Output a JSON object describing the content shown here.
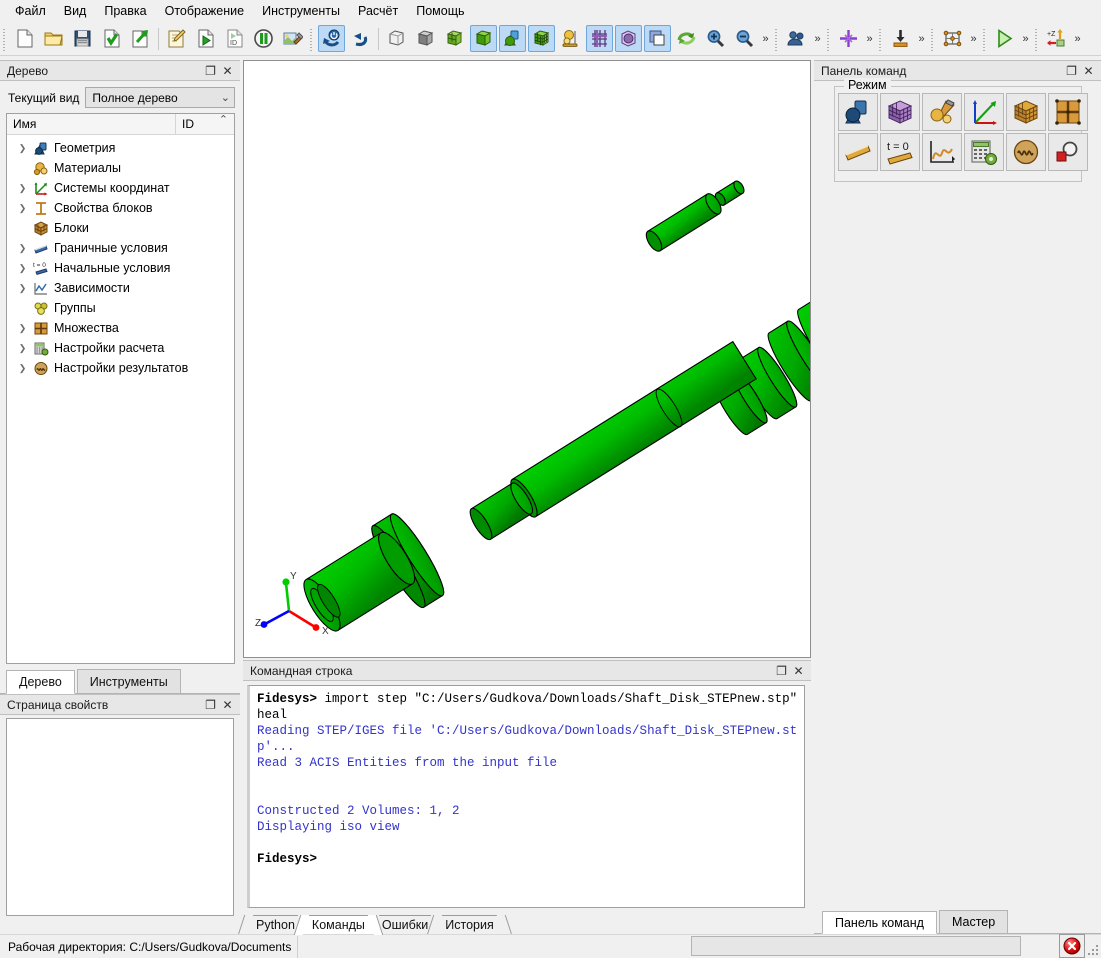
{
  "menubar": {
    "items": [
      {
        "label": "Файл",
        "name": "menu-file"
      },
      {
        "label": "Вид",
        "name": "menu-view"
      },
      {
        "label": "Правка",
        "name": "menu-edit"
      },
      {
        "label": "Отображение",
        "name": "menu-display"
      },
      {
        "label": "Инструменты",
        "name": "menu-tools"
      },
      {
        "label": "Расчёт",
        "name": "menu-calc"
      },
      {
        "label": "Помощь",
        "name": "menu-help"
      }
    ]
  },
  "toolbar": {
    "overflow_glyph": "»",
    "groups": [
      {
        "name": "file-toolbar",
        "buttons": [
          {
            "icon": "new-document-icon",
            "checked": false
          },
          {
            "icon": "open-folder-icon",
            "checked": false
          },
          {
            "icon": "save-icon",
            "checked": false
          },
          {
            "icon": "import-icon",
            "checked": false
          },
          {
            "icon": "export-icon",
            "checked": false
          },
          {
            "sep": true
          },
          {
            "icon": "edit-journal-icon",
            "checked": false
          },
          {
            "icon": "play-journal-icon",
            "checked": false
          },
          {
            "icon": "journal-id-icon",
            "checked": false
          },
          {
            "icon": "pause-icon",
            "checked": false
          },
          {
            "icon": "build-icon",
            "checked": false
          }
        ]
      },
      {
        "name": "undo-redo-toolbar",
        "buttons": [
          {
            "icon": "reset-icon",
            "checked": true
          },
          {
            "icon": "undo-icon",
            "checked": false
          },
          {
            "sep": true
          },
          {
            "icon": "wireframe-icon",
            "checked": false
          },
          {
            "icon": "hidden-line-icon",
            "checked": false
          },
          {
            "icon": "shaded-wireframe-icon",
            "checked": false
          },
          {
            "icon": "shaded-icon",
            "checked": true
          },
          {
            "icon": "smooth-shade-icon",
            "checked": true
          },
          {
            "icon": "mesh-shaded-icon",
            "checked": true
          },
          {
            "icon": "composite-icon",
            "checked": false
          },
          {
            "icon": "grid-icon",
            "checked": true
          },
          {
            "icon": "transparency-icon",
            "checked": true
          },
          {
            "icon": "clip-plane-icon",
            "checked": true
          },
          {
            "icon": "refresh-view-icon",
            "checked": false
          },
          {
            "icon": "zoom-in-icon",
            "checked": false
          },
          {
            "icon": "zoom-out-icon",
            "checked": false
          }
        ]
      },
      {
        "name": "group-toolbar",
        "buttons": [
          {
            "icon": "groups-icon",
            "checked": false
          }
        ]
      },
      {
        "name": "picking-toolbar",
        "buttons": [
          {
            "icon": "crosshair-icon",
            "checked": false
          }
        ]
      },
      {
        "name": "boundary-toolbar",
        "buttons": [
          {
            "icon": "load-arrow-icon",
            "checked": false
          }
        ]
      },
      {
        "name": "mesh-toolbar",
        "buttons": [
          {
            "icon": "mesh-nodes-icon",
            "checked": false
          }
        ]
      },
      {
        "name": "run-toolbar",
        "buttons": [
          {
            "icon": "run-play-icon",
            "checked": false
          }
        ]
      },
      {
        "name": "view-axis-toolbar",
        "buttons": [
          {
            "icon": "plus-z-view-icon",
            "checked": false
          }
        ]
      }
    ]
  },
  "tree_panel": {
    "title": "Дерево",
    "restore_glyph": "❐",
    "close_glyph": "✕",
    "view_label": "Текущий вид",
    "view_value": "Полное дерево",
    "chevron_glyph": "⌄",
    "columns": {
      "name": "Имя",
      "id": "ID"
    },
    "sort_glyph": "⌃",
    "items": [
      {
        "label": "Геометрия",
        "icon": "geometry-icon",
        "expandable": true
      },
      {
        "label": "Материалы",
        "icon": "materials-icon",
        "expandable": false
      },
      {
        "label": "Системы координат",
        "icon": "coordinate-systems-icon",
        "expandable": true
      },
      {
        "label": "Свойства блоков",
        "icon": "block-properties-icon",
        "expandable": true
      },
      {
        "label": "Блоки",
        "icon": "blocks-icon",
        "expandable": false
      },
      {
        "label": "Граничные условия",
        "icon": "boundary-conditions-icon",
        "expandable": true
      },
      {
        "label": "Начальные условия",
        "icon": "initial-conditions-icon",
        "expandable": true
      },
      {
        "label": "Зависимости",
        "icon": "dependencies-icon",
        "expandable": true
      },
      {
        "label": "Группы",
        "icon": "groups-icon",
        "expandable": false
      },
      {
        "label": "Множества",
        "icon": "sets-icon",
        "expandable": true
      },
      {
        "label": "Настройки расчета",
        "icon": "solver-settings-icon",
        "expandable": true
      },
      {
        "label": "Настройки результатов",
        "icon": "result-settings-icon",
        "expandable": true
      }
    ]
  },
  "left_tabs": [
    {
      "label": "Дерево",
      "active": true
    },
    {
      "label": "Инструменты",
      "active": false
    }
  ],
  "properties_panel": {
    "title": "Страница свойств",
    "restore_glyph": "❐",
    "close_glyph": "✕"
  },
  "viewport": {
    "axes": {
      "x": "X",
      "y": "Y",
      "z": "Z"
    },
    "colors": {
      "body_green": "#00b400",
      "body_green_dark": "#007a00",
      "disk_olive": "#a8a800",
      "disk_olive_dark": "#8a8a00",
      "background": "#ffffff",
      "axis_x": "#ff0000",
      "axis_y": "#00cc00",
      "axis_z": "#0000ff"
    }
  },
  "command_panel": {
    "title": "Командная строка",
    "restore_glyph": "❐",
    "close_glyph": "✕",
    "output_lines": [
      {
        "type": "prompt",
        "text": "Fidesys> "
      },
      {
        "type": "cmd",
        "text": "import step \"C:/Users/Gudkova/Downloads/Shaft_Disk_STEPnew.stp\" heal"
      },
      {
        "type": "info",
        "text": "Reading STEP/IGES file 'C:/Users/Gudkova/Downloads/Shaft_Disk_STEPnew.stp'..."
      },
      {
        "type": "info",
        "text": "Read 3 ACIS Entities from the input file"
      },
      {
        "type": "blank",
        "text": ""
      },
      {
        "type": "blank",
        "text": ""
      },
      {
        "type": "info",
        "text": "Constructed 2 Volumes: 1, 2"
      },
      {
        "type": "info",
        "text": "Displaying iso view"
      },
      {
        "type": "blank",
        "text": ""
      },
      {
        "type": "prompt",
        "text": "Fidesys> "
      }
    ],
    "tabs": [
      {
        "label": "Python",
        "active": false
      },
      {
        "label": "Команды",
        "active": true
      },
      {
        "label": "Ошибки",
        "active": false
      },
      {
        "label": "История",
        "active": false
      }
    ]
  },
  "right_panel": {
    "title": "Панель команд",
    "restore_glyph": "❐",
    "close_glyph": "✕",
    "mode_legend": "Режим",
    "mode_buttons": [
      {
        "icon": "geometry-mode-icon"
      },
      {
        "icon": "mesh-mode-icon"
      },
      {
        "icon": "materials-mode-icon"
      },
      {
        "icon": "coordinate-mode-icon"
      },
      {
        "icon": "blocks-mode-icon"
      },
      {
        "icon": "sets-mode-icon"
      },
      {
        "icon": "boundary-conditions-mode-icon"
      },
      {
        "icon": "initial-conditions-mode-icon"
      },
      {
        "icon": "dependencies-mode-icon"
      },
      {
        "icon": "solver-settings-mode-icon"
      },
      {
        "icon": "results-mode-icon"
      },
      {
        "icon": "postprocessor-mode-icon"
      }
    ],
    "tabs": [
      {
        "label": "Панель команд",
        "active": true
      },
      {
        "label": "Мастер",
        "active": false
      }
    ]
  },
  "statusbar": {
    "working_dir_text": "Рабочая директория: C:/Users/Gudkova/Documents",
    "command_field_value": "",
    "abort_icon": "abort-icon"
  }
}
